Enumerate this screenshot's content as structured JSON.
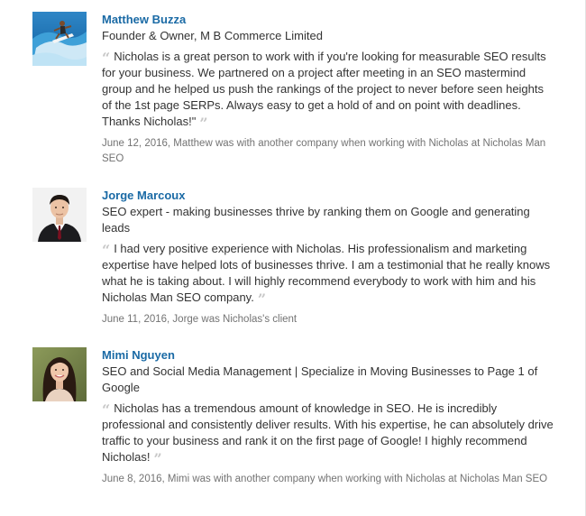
{
  "recommendations": [
    {
      "name": "Matthew Buzza",
      "headline": "Founder & Owner, M B Commerce Limited",
      "text": "Nicholas is a great person to work with if you're looking for measurable SEO results for your business. We partnered on a project after meeting in an SEO mastermind group and he helped us push the rankings of the project to never before seen heights of the 1st page SERPs. Always easy to get a hold of and on point with deadlines. Thanks Nicholas!\"",
      "meta": "June 12, 2016, Matthew was with another company when working with Nicholas at Nicholas Man SEO",
      "avatar_icon": "surfer-photo"
    },
    {
      "name": "Jorge Marcoux",
      "headline": "SEO expert - making businesses thrive by ranking them on Google and generating leads",
      "text": "I had very positive experience with Nicholas. His professionalism and marketing expertise have helped lots of businesses thrive. I am a testimonial that he really knows what he is taking about. I will highly recommend everybody to work with him and his Nicholas Man SEO company.",
      "meta": "June 11, 2016, Jorge was Nicholas's client",
      "avatar_icon": "man-in-suit-photo"
    },
    {
      "name": "Mimi Nguyen",
      "headline": "SEO and Social Media Management | Specialize in Moving Businesses to Page 1 of Google",
      "text": "Nicholas has a tremendous amount of knowledge in SEO. He is incredibly professional and consistently deliver results. With his expertise, he can absolutely drive traffic to your business and rank it on the first page of Google! I highly recommend Nicholas!",
      "meta": "June 8, 2016, Mimi was with another company when working with Nicholas at Nicholas Man SEO",
      "avatar_icon": "woman-portrait-photo"
    }
  ],
  "quote_marks": {
    "open": "“",
    "close": "”"
  },
  "colors": {
    "name_link": "#1a6aa5",
    "body_text": "#333333",
    "meta_text": "#737373",
    "quote_mark": "#c7c7c7"
  }
}
